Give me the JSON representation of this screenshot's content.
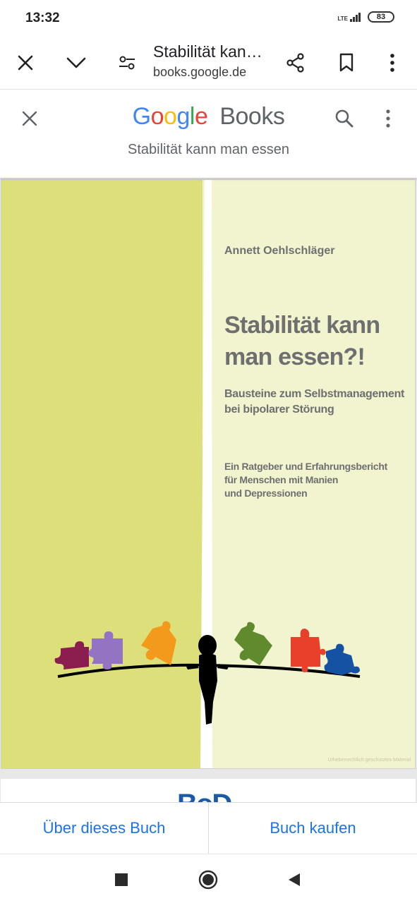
{
  "status_bar": {
    "time": "13:32",
    "network": "LTE",
    "battery": "83"
  },
  "browser": {
    "title": "Stabilität kan…",
    "url": "books.google.de",
    "icons": [
      "close-icon",
      "chevron-down-icon",
      "page-settings-icon",
      "share-icon",
      "bookmark-icon",
      "more-vert-icon"
    ]
  },
  "google_books": {
    "logo_google": [
      "G",
      "o",
      "o",
      "g",
      "l",
      "e"
    ],
    "logo_colors": [
      "#4285F4",
      "#EA4335",
      "#FBBC05",
      "#4285F4",
      "#34A853",
      "#EA4335"
    ],
    "logo_books": "Books",
    "subtitle": "Stabilität kann man essen"
  },
  "cover": {
    "author": "Annett Oehlschläger",
    "title_line1": "Stabilität kann",
    "title_line2": "man essen?!",
    "subtitle_line1": "Bausteine zum Selbstmanagement",
    "subtitle_line2": "bei bipolarer Störung",
    "desc_line1": "Ein Ratgeber und Erfahrungsbericht",
    "desc_line2": "für Menschen mit Manien",
    "desc_line3": "und Depressionen",
    "watermark": "Urheberrechtlich geschütztes Material",
    "colors": {
      "left_panel": "#dde07a",
      "right_panel": "#f2f3cf",
      "text": "#6f6f6f",
      "puzzle": [
        "#8b1e4f",
        "#9473c2",
        "#f39a1c",
        "#5f8a2e",
        "#e8402a",
        "#1552a3"
      ]
    }
  },
  "next_page": {
    "publisher_logo": "BoD"
  },
  "actions": {
    "about_label": "Über dieses Buch",
    "buy_label": "Buch kaufen"
  },
  "nav": {
    "icons": [
      "recents-square-icon",
      "home-circle-icon",
      "back-triangle-icon"
    ]
  },
  "accent_color": "#1a73e8"
}
